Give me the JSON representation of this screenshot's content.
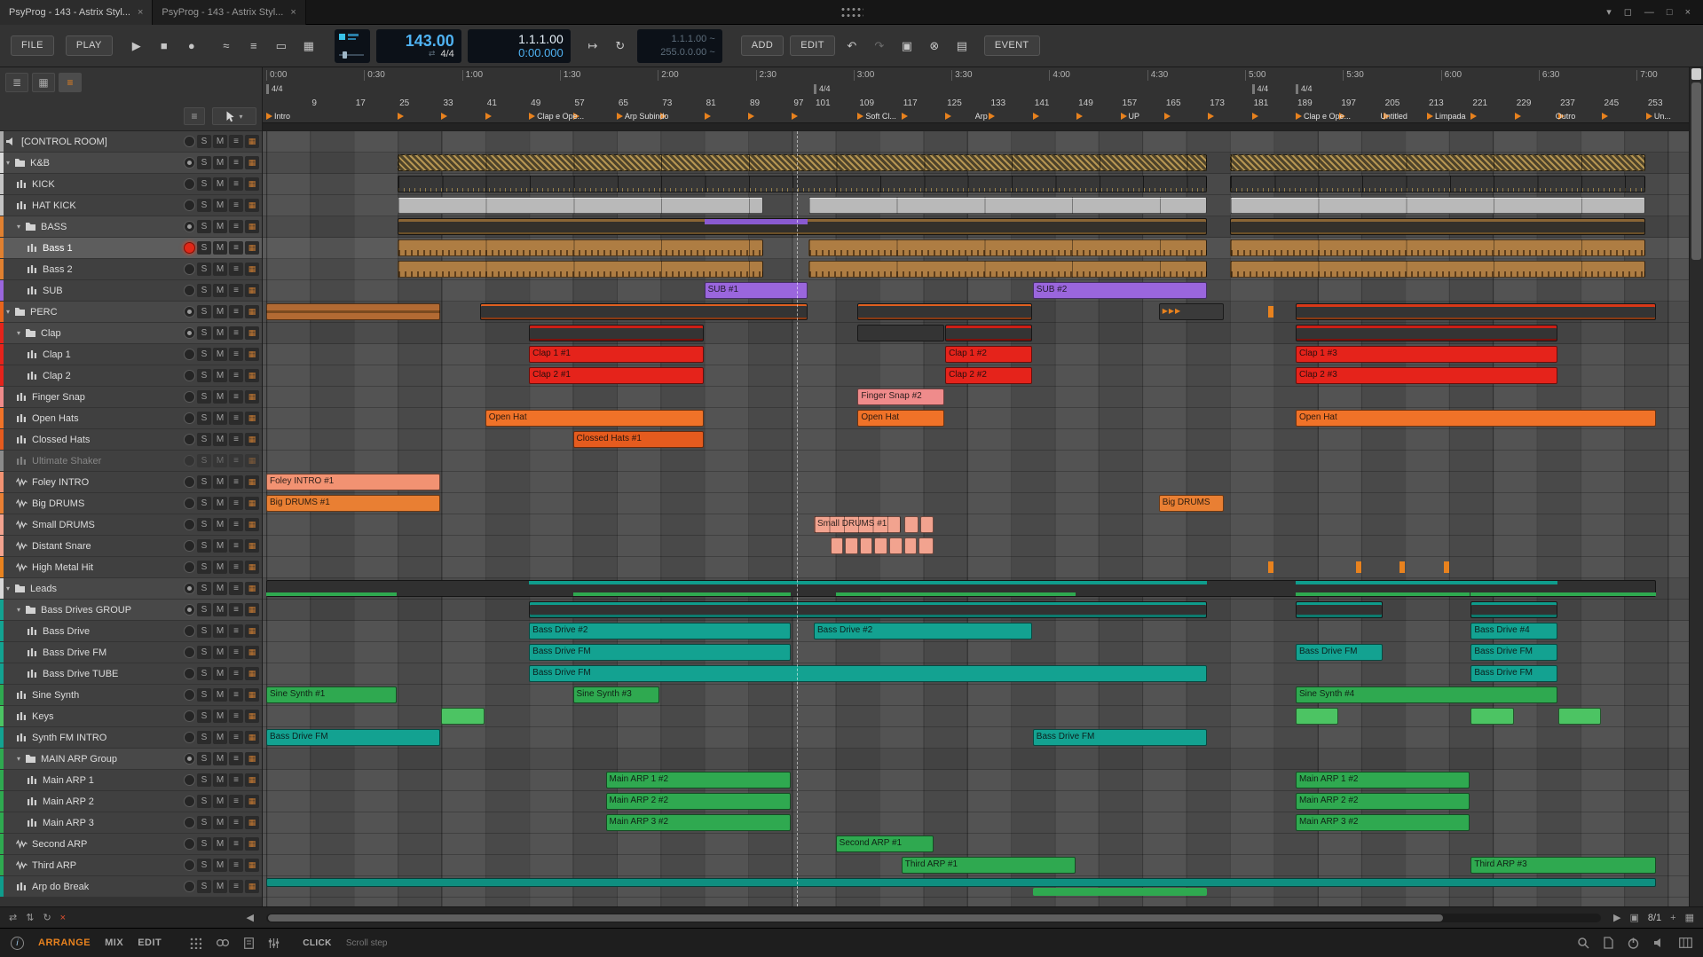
{
  "titlebar": {
    "tabs": [
      {
        "label": "PsyProg - 143 - Astrix Styl...",
        "close": "×"
      },
      {
        "label": "PsyProg - 143 - Astrix Styl...",
        "close": "×"
      }
    ],
    "window_buttons": {
      "menu": "▾",
      "restore": "◻",
      "minimize": "—",
      "maximize": "□",
      "close": "×"
    }
  },
  "toolbar": {
    "file": "FILE",
    "play": "PLAY",
    "tempo": "143.00",
    "timesig": "4/4",
    "position_bars": "1.1.1.00",
    "position_time": "0:00.000",
    "loop_start": "1.1.1.00 ~",
    "loop_length": "255.0.0.00 ~",
    "add": "ADD",
    "edit": "EDIT",
    "event": "EVENT"
  },
  "ruler": {
    "times": [
      "0:00",
      "0:30",
      "1:00",
      "1:30",
      "2:00",
      "2:30",
      "3:00",
      "3:30",
      "4:00",
      "4:30",
      "5:00",
      "5:30",
      "6:00",
      "6:30",
      "7:00"
    ],
    "bar_numbers": [
      9,
      17,
      25,
      33,
      41,
      49,
      57,
      65,
      73,
      81,
      89,
      97,
      101,
      109,
      117,
      125,
      133,
      141,
      149,
      157,
      165,
      173,
      181,
      189,
      197,
      205,
      213,
      221,
      229,
      237,
      245,
      253
    ],
    "timesigs": [
      {
        "bar": 1,
        "label": "4/4"
      },
      {
        "bar": 101,
        "label": "4/4"
      },
      {
        "bar": 181,
        "label": "4/4"
      },
      {
        "bar": 189,
        "label": "4/4"
      }
    ],
    "cues": [
      1,
      25,
      33,
      41,
      49,
      57,
      65,
      73,
      81,
      89,
      97,
      109,
      117,
      125,
      133,
      141,
      149,
      157,
      165,
      173,
      181,
      189,
      197,
      205,
      213,
      221,
      229,
      237,
      245,
      253
    ],
    "markers": [
      {
        "bar": 1,
        "label": "Intro"
      },
      {
        "bar": 49,
        "label": "Clap e Ope..."
      },
      {
        "bar": 65,
        "label": "Arp Subindo"
      },
      {
        "bar": 109,
        "label": "Soft Cl..."
      },
      {
        "bar": 129,
        "label": "Arp"
      },
      {
        "bar": 157,
        "label": "UP"
      },
      {
        "bar": 189,
        "label": "Clap e Ope..."
      },
      {
        "bar": 203,
        "label": "Untitled"
      },
      {
        "bar": 213,
        "label": "Limpada"
      },
      {
        "bar": 235,
        "label": "Outro"
      },
      {
        "bar": 253,
        "label": "Un..."
      }
    ]
  },
  "edit_cursor_bar": 98,
  "track_controls": {
    "solo": "S",
    "mute": "M"
  },
  "tracks": [
    {
      "name": "[CONTROL ROOM]",
      "level": 0,
      "kind": "special",
      "color": "#a8a8a8",
      "clips": []
    },
    {
      "name": "K&B",
      "level": 0,
      "kind": "group",
      "color": "#d8d8d8",
      "clips": [
        {
          "s": 25,
          "l": 148,
          "cls": "hatch"
        },
        {
          "s": 177,
          "l": 76,
          "cls": "hatch"
        }
      ]
    },
    {
      "name": "KICK",
      "level": 1,
      "kind": "inst",
      "color": "#c4c4c4",
      "clips": [
        {
          "s": 25,
          "l": 148,
          "cls": "kick"
        },
        {
          "s": 177,
          "l": 76,
          "cls": "kick"
        }
      ]
    },
    {
      "name": "HAT KICK",
      "level": 1,
      "kind": "inst",
      "color": "#c4c4c4",
      "clips": [
        {
          "s": 25,
          "l": 67,
          "cls": "grayclip"
        },
        {
          "s": 100,
          "l": 73,
          "cls": "grayclip"
        },
        {
          "s": 177,
          "l": 76,
          "cls": "grayclip"
        }
      ]
    },
    {
      "name": "BASS",
      "level": 1,
      "kind": "group",
      "color": "#e08030",
      "clips": [
        {
          "s": 25,
          "l": 148,
          "cls": "bass-sum"
        },
        {
          "s": 177,
          "l": 76,
          "cls": "bass-sum"
        },
        {
          "s": 81,
          "l": 19,
          "cls": "purple-strip"
        }
      ]
    },
    {
      "name": "Bass 1",
      "level": 2,
      "kind": "inst",
      "color": "#e08030",
      "armed": true,
      "selected": true,
      "clips": [
        {
          "s": 25,
          "l": 67,
          "cls": "bassclip"
        },
        {
          "s": 100,
          "l": 73,
          "cls": "bassclip"
        },
        {
          "s": 177,
          "l": 76,
          "cls": "bassclip"
        }
      ]
    },
    {
      "name": "Bass 2",
      "level": 2,
      "kind": "inst",
      "color": "#e08030",
      "clips": [
        {
          "s": 25,
          "l": 67,
          "cls": "bassclip"
        },
        {
          "s": 100,
          "l": 73,
          "cls": "bassclip"
        },
        {
          "s": 177,
          "l": 76,
          "cls": "bassclip"
        }
      ]
    },
    {
      "name": "SUB",
      "level": 2,
      "kind": "inst",
      "color": "#9a66dd",
      "clips": [
        {
          "s": 81,
          "l": 19,
          "cls": "purple",
          "label": "SUB #1"
        },
        {
          "s": 141,
          "l": 32,
          "cls": "purple",
          "label": "SUB #2"
        }
      ]
    },
    {
      "name": "PERC",
      "level": 0,
      "kind": "group",
      "color": "#e8641c",
      "clips": [
        {
          "s": 1,
          "l": 32,
          "cls": "perc-audio"
        },
        {
          "s": 40,
          "l": 60,
          "cls": "perc-sum"
        },
        {
          "s": 109,
          "l": 32,
          "cls": "perc-sum"
        },
        {
          "s": 164,
          "l": 12,
          "cls": "arrowclip",
          "label": "▶▶▶"
        },
        {
          "s": 184,
          "l": 0.5,
          "cls": "tickclip"
        },
        {
          "s": 189,
          "l": 66,
          "cls": "perc-sum2"
        }
      ]
    },
    {
      "name": "Clap",
      "level": 1,
      "kind": "group",
      "color": "#e5231b",
      "clips": [
        {
          "s": 49,
          "l": 32,
          "cls": "clap-sum"
        },
        {
          "s": 109,
          "l": 16,
          "cls": "darkclip"
        },
        {
          "s": 125,
          "l": 16,
          "cls": "clap-sum"
        },
        {
          "s": 189,
          "l": 48,
          "cls": "clap-sum"
        }
      ]
    },
    {
      "name": "Clap 1",
      "level": 2,
      "kind": "inst",
      "color": "#e5231b",
      "clips": [
        {
          "s": 49,
          "l": 32,
          "cls": "red",
          "label": "Clap 1 #1"
        },
        {
          "s": 125,
          "l": 16,
          "cls": "red",
          "label": "Clap 1 #2"
        },
        {
          "s": 189,
          "l": 48,
          "cls": "red",
          "label": "Clap 1 #3"
        }
      ]
    },
    {
      "name": "Clap 2",
      "level": 2,
      "kind": "inst",
      "color": "#e5231b",
      "clips": [
        {
          "s": 49,
          "l": 32,
          "cls": "red",
          "label": "Clap 2 #1"
        },
        {
          "s": 125,
          "l": 16,
          "cls": "red",
          "label": "Clap 2 #2"
        },
        {
          "s": 189,
          "l": 48,
          "cls": "red",
          "label": "Clap 2 #3"
        }
      ]
    },
    {
      "name": "Finger Snap",
      "level": 1,
      "kind": "inst",
      "color": "#ef8b8b",
      "clips": [
        {
          "s": 109,
          "l": 16,
          "cls": "pink",
          "label": "Finger Snap #2"
        }
      ]
    },
    {
      "name": "Open Hats",
      "level": 1,
      "kind": "inst",
      "color": "#f07228",
      "clips": [
        {
          "s": 41,
          "l": 40,
          "cls": "orange",
          "label": "Open Hat"
        },
        {
          "s": 109,
          "l": 16,
          "cls": "orange",
          "label": "Open Hat"
        },
        {
          "s": 189,
          "l": 66,
          "cls": "orange",
          "label": "Open Hat"
        }
      ]
    },
    {
      "name": "Clossed Hats",
      "level": 1,
      "kind": "inst",
      "color": "#e55b1e",
      "clips": [
        {
          "s": 57,
          "l": 24,
          "cls": "orangedark",
          "label": "Clossed Hats #1"
        }
      ]
    },
    {
      "name": "Ultimate Shaker",
      "level": 1,
      "kind": "inst",
      "color": "#8a8a8a",
      "disabled": true,
      "clips": []
    },
    {
      "name": "Foley INTRO",
      "level": 1,
      "kind": "audio",
      "color": "#f29272",
      "clips": [
        {
          "s": 1,
          "l": 32,
          "cls": "foley",
          "label": "Foley INTRO #1"
        }
      ]
    },
    {
      "name": "Big DRUMS",
      "level": 1,
      "kind": "audio",
      "color": "#e97f33",
      "clips": [
        {
          "s": 1,
          "l": 32,
          "cls": "bigdrums",
          "label": "Big DRUMS #1"
        },
        {
          "s": 164,
          "l": 12,
          "cls": "bigdrums",
          "label": "Big DRUMS"
        }
      ]
    },
    {
      "name": "Small DRUMS",
      "level": 1,
      "kind": "audio",
      "color": "#f2a38f",
      "clips": [
        {
          "s": 101,
          "l": 16,
          "cls": "salmonseg",
          "label": "Small DRUMS #1"
        },
        {
          "s": 117.5,
          "l": 2.8,
          "cls": "salmon"
        },
        {
          "s": 120.4,
          "l": 2.7,
          "cls": "salmon"
        }
      ]
    },
    {
      "name": "Distant Snare",
      "level": 1,
      "kind": "audio",
      "color": "#f2a38f",
      "clips": [
        {
          "s": 104,
          "l": 2.5,
          "cls": "salmon"
        },
        {
          "s": 106.7,
          "l": 2.5,
          "cls": "salmon"
        },
        {
          "s": 109.4,
          "l": 2.5,
          "cls": "salmon"
        },
        {
          "s": 112.1,
          "l": 2.5,
          "cls": "salmon"
        },
        {
          "s": 114.8,
          "l": 2.5,
          "cls": "salmon"
        },
        {
          "s": 117.5,
          "l": 2.5,
          "cls": "salmon"
        },
        {
          "s": 120.2,
          "l": 2.8,
          "cls": "salmon"
        }
      ]
    },
    {
      "name": "High Metal Hit",
      "level": 1,
      "kind": "audio",
      "color": "#e8821e",
      "clips": [
        {
          "s": 184,
          "l": 0.4,
          "cls": "tickclip"
        },
        {
          "s": 200,
          "l": 0.4,
          "cls": "tickclip"
        },
        {
          "s": 208,
          "l": 0.4,
          "cls": "tickclip"
        },
        {
          "s": 216,
          "l": 0.4,
          "cls": "tickclip"
        }
      ]
    },
    {
      "name": "Leads",
      "level": 0,
      "kind": "group",
      "color": "#d8d8d8",
      "clips": [
        {
          "s": 1,
          "l": 254,
          "cls": "leads-base"
        },
        {
          "s": 49,
          "l": 124,
          "cls": "strip-teal"
        },
        {
          "s": 189,
          "l": 48,
          "cls": "strip-teal"
        },
        {
          "s": 1,
          "l": 24,
          "cls": "strip-green"
        },
        {
          "s": 57,
          "l": 40,
          "cls": "strip-green"
        },
        {
          "s": 105,
          "l": 18,
          "cls": "strip-green"
        },
        {
          "s": 117,
          "l": 32,
          "cls": "strip-green"
        },
        {
          "s": 189,
          "l": 32,
          "cls": "strip-green"
        },
        {
          "s": 221,
          "l": 34,
          "cls": "strip-green"
        }
      ]
    },
    {
      "name": "Bass Drives GROUP",
      "level": 1,
      "kind": "group",
      "color": "#13a291",
      "clips": [
        {
          "s": 49,
          "l": 124,
          "cls": "drives-sum"
        },
        {
          "s": 189,
          "l": 16,
          "cls": "drives-sum"
        },
        {
          "s": 221,
          "l": 16,
          "cls": "drives-sum"
        }
      ]
    },
    {
      "name": "Bass Drive",
      "level": 2,
      "kind": "inst",
      "color": "#13a291",
      "clips": [
        {
          "s": 49,
          "l": 48,
          "cls": "teal",
          "label": "Bass Drive #2"
        },
        {
          "s": 101,
          "l": 40,
          "cls": "teal",
          "label": "Bass Drive #2"
        },
        {
          "s": 221,
          "l": 16,
          "cls": "teal",
          "label": "Bass Drive #4"
        }
      ]
    },
    {
      "name": "Bass Drive FM",
      "level": 2,
      "kind": "inst",
      "color": "#13a291",
      "clips": [
        {
          "s": 49,
          "l": 48,
          "cls": "teal",
          "label": "Bass Drive FM"
        },
        {
          "s": 189,
          "l": 16,
          "cls": "teal",
          "label": "Bass Drive FM"
        },
        {
          "s": 221,
          "l": 16,
          "cls": "teal",
          "label": "Bass Drive FM"
        }
      ]
    },
    {
      "name": "Bass Drive TUBE",
      "level": 2,
      "kind": "inst",
      "color": "#13a291",
      "clips": [
        {
          "s": 49,
          "l": 124,
          "cls": "teal",
          "label": "Bass Drive FM"
        },
        {
          "s": 221,
          "l": 16,
          "cls": "teal",
          "label": "Bass Drive FM"
        }
      ]
    },
    {
      "name": "Sine Synth",
      "level": 1,
      "kind": "inst",
      "color": "#2fa950",
      "clips": [
        {
          "s": 1,
          "l": 24,
          "cls": "green",
          "label": "Sine Synth #1"
        },
        {
          "s": 57,
          "l": 16,
          "cls": "green",
          "label": "Sine Synth #3"
        },
        {
          "s": 189,
          "l": 48,
          "cls": "green",
          "label": "Sine Synth #4"
        }
      ]
    },
    {
      "name": "Keys",
      "level": 1,
      "kind": "inst",
      "color": "#4cc463",
      "clips": [
        {
          "s": 33,
          "l": 8,
          "cls": "lightgreen"
        },
        {
          "s": 189,
          "l": 8,
          "cls": "lightgreen"
        },
        {
          "s": 221,
          "l": 8,
          "cls": "lightgreen"
        },
        {
          "s": 237,
          "l": 8,
          "cls": "lightgreen"
        }
      ]
    },
    {
      "name": "Synth FM INTRO",
      "level": 1,
      "kind": "inst",
      "color": "#13a291",
      "clips": [
        {
          "s": 1,
          "l": 32,
          "cls": "teal",
          "label": "Bass Drive FM"
        },
        {
          "s": 141,
          "l": 32,
          "cls": "teal",
          "label": "Bass Drive FM"
        }
      ]
    },
    {
      "name": "MAIN ARP Group",
      "level": 1,
      "kind": "group",
      "color": "#2fa950",
      "clips": []
    },
    {
      "name": "Main ARP 1",
      "level": 2,
      "kind": "inst",
      "color": "#2fa950",
      "clips": [
        {
          "s": 63,
          "l": 34,
          "cls": "green",
          "label": "Main ARP 1 #2"
        },
        {
          "s": 189,
          "l": 32,
          "cls": "green",
          "label": "Main ARP 1 #2"
        }
      ]
    },
    {
      "name": "Main ARP 2",
      "level": 2,
      "kind": "inst",
      "color": "#2fa950",
      "clips": [
        {
          "s": 63,
          "l": 34,
          "cls": "green",
          "label": "Main ARP 2 #2"
        },
        {
          "s": 189,
          "l": 32,
          "cls": "green",
          "label": "Main ARP 2 #2"
        }
      ]
    },
    {
      "name": "Main ARP 3",
      "level": 2,
      "kind": "inst",
      "color": "#2fa950",
      "clips": [
        {
          "s": 63,
          "l": 34,
          "cls": "green",
          "label": "Main ARP 3 #2"
        },
        {
          "s": 189,
          "l": 32,
          "cls": "green",
          "label": "Main ARP 3 #2"
        }
      ]
    },
    {
      "name": "Second ARP",
      "level": 1,
      "kind": "audio",
      "color": "#2fa950",
      "clips": [
        {
          "s": 105,
          "l": 18,
          "cls": "green",
          "label": "Second ARP #1"
        }
      ]
    },
    {
      "name": "Third ARP",
      "level": 1,
      "kind": "audio",
      "color": "#2fa950",
      "clips": [
        {
          "s": 117,
          "l": 32,
          "cls": "green",
          "label": "Third ARP #1"
        },
        {
          "s": 221,
          "l": 34,
          "cls": "green",
          "label": "Third ARP #3"
        }
      ]
    },
    {
      "name": "Arp do Break",
      "level": 1,
      "kind": "inst",
      "color": "#0f9c8c",
      "clips": [
        {
          "s": 1,
          "l": 254,
          "cls": "break-teal"
        },
        {
          "s": 141,
          "l": 32,
          "cls": "break-green"
        }
      ]
    }
  ],
  "scrollbar": {
    "grid_value": "8/1"
  },
  "statusbar": {
    "views": [
      {
        "label": "ARRANGE",
        "active": true
      },
      {
        "label": "MIX",
        "active": false
      },
      {
        "label": "EDIT",
        "active": false
      }
    ],
    "click": "CLICK",
    "hint": "Scroll step"
  }
}
